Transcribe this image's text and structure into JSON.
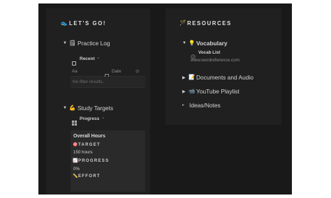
{
  "left": {
    "heading_emoji": "👟",
    "heading": "LET'S GO!",
    "practice_log": {
      "toggle": "▼",
      "icon": "🗒",
      "label": "Practice Log",
      "view_icon": "table-icon",
      "view_label": "Recent",
      "view_chevron": "⌄",
      "columns": [
        "Aa",
        "Date"
      ],
      "col_icon": "⊙",
      "empty_text": "No filter results."
    },
    "study_targets": {
      "toggle": "▼",
      "icon": "💪",
      "label": "Study Targets",
      "view_icon": "gallery-icon",
      "view_label": "Progress",
      "view_chevron": "⌄",
      "card": {
        "title": "Overall Hours",
        "target_icon": "🎯",
        "target_label": "TARGET",
        "target_value": "150 hours",
        "progress_icon": "📈",
        "progress_label": "PROGRESS",
        "progress_value": "0%",
        "effort_icon": "✏️",
        "effort_label": "EFFORT"
      }
    }
  },
  "right": {
    "heading_emoji": "🪄",
    "heading": "RESOURCES",
    "items": [
      {
        "toggle": "▼",
        "icon": "💡",
        "label": "Vocabulary"
      },
      {
        "toggle": "▶",
        "icon": "📝",
        "label": "Documents and Audio"
      },
      {
        "toggle": "▶",
        "icon": "📹",
        "label": "YouTube Playlist"
      },
      {
        "toggle": "▸",
        "icon": "",
        "label": "Ideas/Notes"
      }
    ],
    "vocab_list_label": "Vocab List",
    "vocab_url": "www.wordreference.com"
  }
}
